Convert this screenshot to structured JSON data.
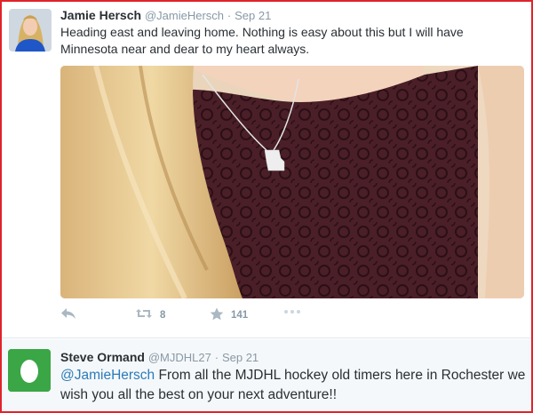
{
  "tweets": [
    {
      "fullname": "Jamie Hersch",
      "handle": "@JamieHersch",
      "time": "Sep 21",
      "text": "Heading east and leaving home. Nothing is easy about this but I will have Minnesota near and dear to my heart always.",
      "actions": {
        "retweets": "8",
        "favorites": "141"
      }
    },
    {
      "fullname": "Steve Ormand",
      "handle": "@MJDHL27",
      "time": "Sep 21",
      "mention": "@JamieHersch",
      "text": " From all the MJDHL hockey old timers here in Rochester we wish you all the best on your next adventure!!"
    }
  ],
  "separator": "·",
  "icons": {
    "reply": "reply-icon",
    "retweet": "retweet-icon",
    "favorite": "star-icon",
    "more": "more-icon"
  },
  "colors": {
    "link": "#2b7bb9",
    "meta": "#8899a6",
    "frame": "#e0232a",
    "default_avatar": "#3aa646"
  }
}
